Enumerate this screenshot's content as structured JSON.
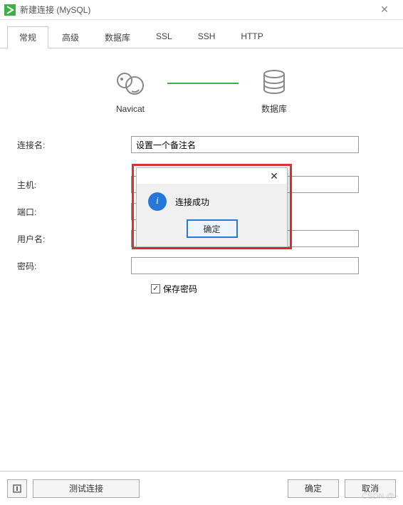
{
  "window": {
    "title": "新建连接 (MySQL)"
  },
  "tabs": [
    {
      "label": "常规",
      "active": true
    },
    {
      "label": "高级",
      "active": false
    },
    {
      "label": "数据库",
      "active": false
    },
    {
      "label": "SSL",
      "active": false
    },
    {
      "label": "SSH",
      "active": false
    },
    {
      "label": "HTTP",
      "active": false
    }
  ],
  "diagram": {
    "left_label": "Navicat",
    "right_label": "数据库"
  },
  "form": {
    "connection_name": {
      "label": "连接名:",
      "value": "设置一个备注名"
    },
    "host": {
      "label": "主机:",
      "value": ""
    },
    "port": {
      "label": "端口:",
      "value": ""
    },
    "username": {
      "label": "用户名:",
      "value": ""
    },
    "password": {
      "label": "密码:",
      "value": ""
    },
    "save_password": {
      "label": "保存密码",
      "checked": true
    }
  },
  "modal": {
    "message": "连接成功",
    "ok_label": "确定"
  },
  "footer": {
    "test_connection": "测试连接",
    "ok": "确定",
    "cancel": "取消"
  },
  "watermark": "CSDN @~"
}
